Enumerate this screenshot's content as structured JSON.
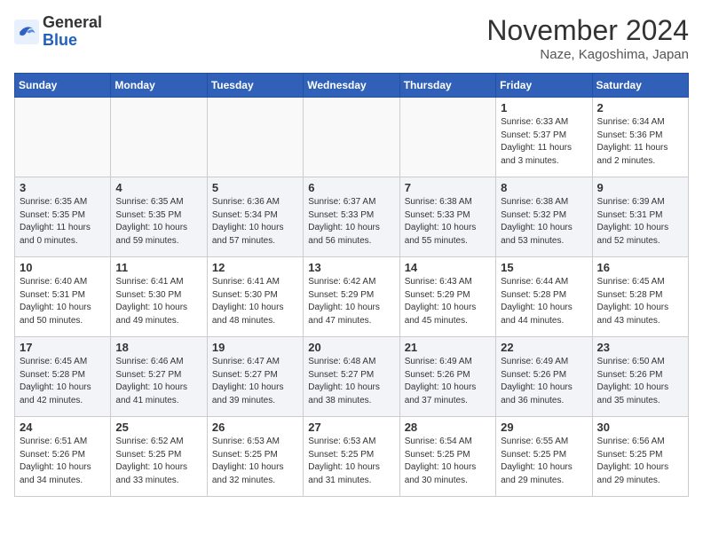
{
  "header": {
    "logo_general": "General",
    "logo_blue": "Blue",
    "month_title": "November 2024",
    "location": "Naze, Kagoshima, Japan"
  },
  "weekdays": [
    "Sunday",
    "Monday",
    "Tuesday",
    "Wednesday",
    "Thursday",
    "Friday",
    "Saturday"
  ],
  "weeks": [
    [
      {
        "day": "",
        "info": ""
      },
      {
        "day": "",
        "info": ""
      },
      {
        "day": "",
        "info": ""
      },
      {
        "day": "",
        "info": ""
      },
      {
        "day": "",
        "info": ""
      },
      {
        "day": "1",
        "info": "Sunrise: 6:33 AM\nSunset: 5:37 PM\nDaylight: 11 hours\nand 3 minutes."
      },
      {
        "day": "2",
        "info": "Sunrise: 6:34 AM\nSunset: 5:36 PM\nDaylight: 11 hours\nand 2 minutes."
      }
    ],
    [
      {
        "day": "3",
        "info": "Sunrise: 6:35 AM\nSunset: 5:35 PM\nDaylight: 11 hours\nand 0 minutes."
      },
      {
        "day": "4",
        "info": "Sunrise: 6:35 AM\nSunset: 5:35 PM\nDaylight: 10 hours\nand 59 minutes."
      },
      {
        "day": "5",
        "info": "Sunrise: 6:36 AM\nSunset: 5:34 PM\nDaylight: 10 hours\nand 57 minutes."
      },
      {
        "day": "6",
        "info": "Sunrise: 6:37 AM\nSunset: 5:33 PM\nDaylight: 10 hours\nand 56 minutes."
      },
      {
        "day": "7",
        "info": "Sunrise: 6:38 AM\nSunset: 5:33 PM\nDaylight: 10 hours\nand 55 minutes."
      },
      {
        "day": "8",
        "info": "Sunrise: 6:38 AM\nSunset: 5:32 PM\nDaylight: 10 hours\nand 53 minutes."
      },
      {
        "day": "9",
        "info": "Sunrise: 6:39 AM\nSunset: 5:31 PM\nDaylight: 10 hours\nand 52 minutes."
      }
    ],
    [
      {
        "day": "10",
        "info": "Sunrise: 6:40 AM\nSunset: 5:31 PM\nDaylight: 10 hours\nand 50 minutes."
      },
      {
        "day": "11",
        "info": "Sunrise: 6:41 AM\nSunset: 5:30 PM\nDaylight: 10 hours\nand 49 minutes."
      },
      {
        "day": "12",
        "info": "Sunrise: 6:41 AM\nSunset: 5:30 PM\nDaylight: 10 hours\nand 48 minutes."
      },
      {
        "day": "13",
        "info": "Sunrise: 6:42 AM\nSunset: 5:29 PM\nDaylight: 10 hours\nand 47 minutes."
      },
      {
        "day": "14",
        "info": "Sunrise: 6:43 AM\nSunset: 5:29 PM\nDaylight: 10 hours\nand 45 minutes."
      },
      {
        "day": "15",
        "info": "Sunrise: 6:44 AM\nSunset: 5:28 PM\nDaylight: 10 hours\nand 44 minutes."
      },
      {
        "day": "16",
        "info": "Sunrise: 6:45 AM\nSunset: 5:28 PM\nDaylight: 10 hours\nand 43 minutes."
      }
    ],
    [
      {
        "day": "17",
        "info": "Sunrise: 6:45 AM\nSunset: 5:28 PM\nDaylight: 10 hours\nand 42 minutes."
      },
      {
        "day": "18",
        "info": "Sunrise: 6:46 AM\nSunset: 5:27 PM\nDaylight: 10 hours\nand 41 minutes."
      },
      {
        "day": "19",
        "info": "Sunrise: 6:47 AM\nSunset: 5:27 PM\nDaylight: 10 hours\nand 39 minutes."
      },
      {
        "day": "20",
        "info": "Sunrise: 6:48 AM\nSunset: 5:27 PM\nDaylight: 10 hours\nand 38 minutes."
      },
      {
        "day": "21",
        "info": "Sunrise: 6:49 AM\nSunset: 5:26 PM\nDaylight: 10 hours\nand 37 minutes."
      },
      {
        "day": "22",
        "info": "Sunrise: 6:49 AM\nSunset: 5:26 PM\nDaylight: 10 hours\nand 36 minutes."
      },
      {
        "day": "23",
        "info": "Sunrise: 6:50 AM\nSunset: 5:26 PM\nDaylight: 10 hours\nand 35 minutes."
      }
    ],
    [
      {
        "day": "24",
        "info": "Sunrise: 6:51 AM\nSunset: 5:26 PM\nDaylight: 10 hours\nand 34 minutes."
      },
      {
        "day": "25",
        "info": "Sunrise: 6:52 AM\nSunset: 5:25 PM\nDaylight: 10 hours\nand 33 minutes."
      },
      {
        "day": "26",
        "info": "Sunrise: 6:53 AM\nSunset: 5:25 PM\nDaylight: 10 hours\nand 32 minutes."
      },
      {
        "day": "27",
        "info": "Sunrise: 6:53 AM\nSunset: 5:25 PM\nDaylight: 10 hours\nand 31 minutes."
      },
      {
        "day": "28",
        "info": "Sunrise: 6:54 AM\nSunset: 5:25 PM\nDaylight: 10 hours\nand 30 minutes."
      },
      {
        "day": "29",
        "info": "Sunrise: 6:55 AM\nSunset: 5:25 PM\nDaylight: 10 hours\nand 29 minutes."
      },
      {
        "day": "30",
        "info": "Sunrise: 6:56 AM\nSunset: 5:25 PM\nDaylight: 10 hours\nand 29 minutes."
      }
    ]
  ]
}
